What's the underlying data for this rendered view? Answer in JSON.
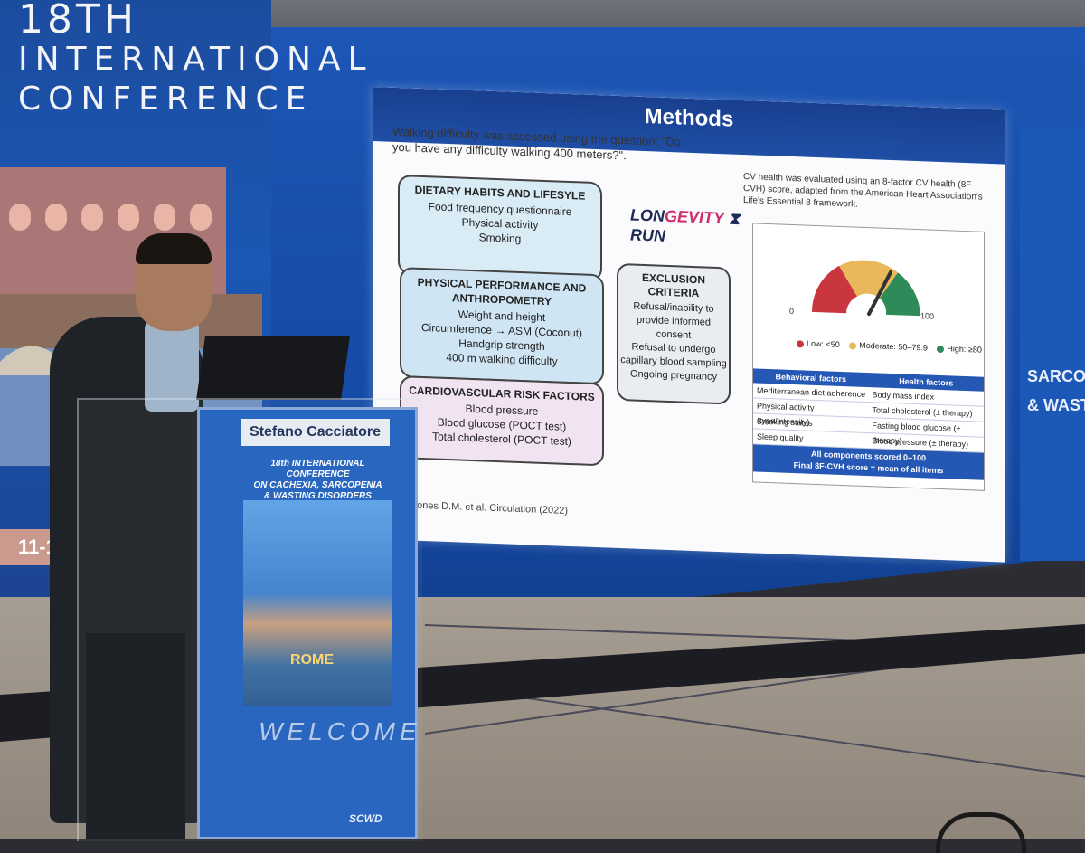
{
  "banner": {
    "line1": "18TH",
    "line2": "INTERNATIONAL",
    "line3": "CONFERENCE",
    "dates": "11-13"
  },
  "right_banner": {
    "line1": "SARCOPEN",
    "line2": "& WASTIN"
  },
  "slide": {
    "title": "Methods",
    "bullet": "Walking difficulty was assessed using the question: \"Do you have any difficulty walking 400 meters?\".",
    "box1": {
      "title": "DIETARY HABITS AND LIFESYLE",
      "items": [
        "Food frequency questionnaire",
        "Physical activity",
        "Smoking"
      ]
    },
    "box2": {
      "title": "PHYSICAL PERFORMANCE AND ANTHROPOMETRY",
      "items": [
        "Weight and height",
        "Circumference → ASM (Coconut)",
        "Handgrip strength",
        "400 m walking difficulty"
      ]
    },
    "box3": {
      "title": "CARDIOVASCULAR RISK FACTORS",
      "items": [
        "Blood pressure",
        "Blood glucose (POCT test)",
        "Total cholesterol (POCT test)"
      ]
    },
    "logo": {
      "part1": "LON",
      "part2": "GEVITY",
      "part3": "RUN"
    },
    "exclusion": {
      "title": "EXCLUSION CRITERIA",
      "items": [
        "Refusal/inability to provide informed consent",
        "Refusal to undergo capillary blood sampling",
        "Ongoing pregnancy"
      ]
    },
    "cv_text": "CV health was evaluated using an 8-factor CV health (8F-CVH) score, adapted from the American Heart Association's Life's Essential 8 framework.",
    "gauge": {
      "min_label": "0",
      "max_label": "100",
      "legend": [
        {
          "label": "Low: <50",
          "color": "#c9363e"
        },
        {
          "label": "Moderate: 50–79.9",
          "color": "#e8b85a"
        },
        {
          "label": "High: ≥80",
          "color": "#2f8a5a"
        }
      ]
    },
    "factors": {
      "head_left": "Behavioral factors",
      "head_right": "Health factors",
      "rows": [
        {
          "left": "Mediterranean diet adherence",
          "right": "Body mass index"
        },
        {
          "left": "Physical activity (type/intensity)",
          "right": "Total cholesterol (± therapy)"
        },
        {
          "left": "Smoking status",
          "right": "Fasting blood glucose (± therapy)"
        },
        {
          "left": "Sleep quality",
          "right": "Blood pressure (± therapy)"
        }
      ],
      "foot1": "All components scored 0–100",
      "foot2": "Final 8F-CVH score = mean of all items"
    },
    "citation": "-Jones D.M. et al. Circulation (2022)"
  },
  "podium": {
    "name": "Stefano Cacciatore",
    "conf_line1": "18th INTERNATIONAL CONFERENCE",
    "conf_line2": "ON CACHEXIA, SARCOPENIA",
    "conf_line3": "& WASTING DISORDERS",
    "city": "ROME",
    "welcome": "WELCOME",
    "logo": "SCWD"
  }
}
